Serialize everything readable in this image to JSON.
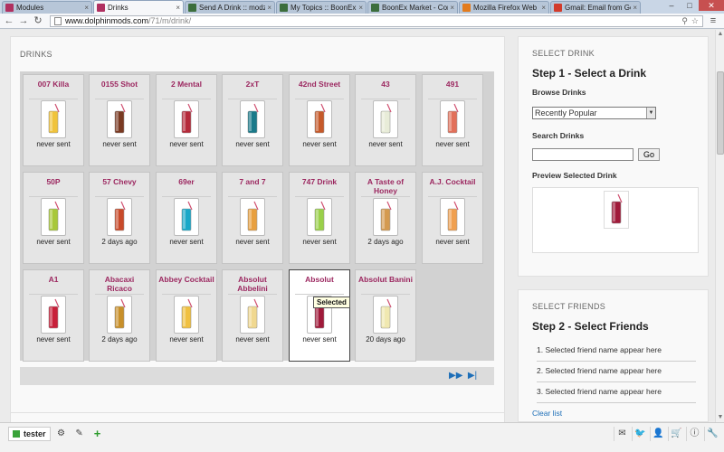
{
  "browser": {
    "tabs": [
      {
        "title": "Modules",
        "favicon_color": "#b03060"
      },
      {
        "title": "Drinks",
        "favicon_color": "#b03060"
      },
      {
        "title": "Send A Drink :: modzzz",
        "favicon_color": "#3c6e3c"
      },
      {
        "title": "My Topics :: BoonEx Uni",
        "favicon_color": "#3c6e3c"
      },
      {
        "title": "BoonEx Market - Comm",
        "favicon_color": "#3c6e3c"
      },
      {
        "title": "Mozilla Firefox Web Bro",
        "favicon_color": "#e27b1e"
      },
      {
        "title": "Gmail: Email from Goog",
        "favicon_color": "#d23b2b"
      }
    ],
    "active_tab_index": 1,
    "url_host": "www.dolphinmods.com",
    "url_path": "/71/m/drink/"
  },
  "drinks": {
    "title": "DRINKS",
    "items": [
      {
        "name": "007 Killa",
        "status": "never sent",
        "color": "#f0c33c"
      },
      {
        "name": "0155 Shot",
        "status": "never sent",
        "color": "#7a3a22"
      },
      {
        "name": "2 Mental",
        "status": "never sent",
        "color": "#b52a3a"
      },
      {
        "name": "2xT",
        "status": "never sent",
        "color": "#1b7a8a"
      },
      {
        "name": "42nd Street",
        "status": "never sent",
        "color": "#c65a2a"
      },
      {
        "name": "43",
        "status": "never sent",
        "color": "#e8ecd8"
      },
      {
        "name": "491",
        "status": "never sent",
        "color": "#e2705a"
      },
      {
        "name": "50P",
        "status": "never sent",
        "color": "#a8c83a"
      },
      {
        "name": "57 Chevy",
        "status": "2 days ago",
        "color": "#c84a2a"
      },
      {
        "name": "69er",
        "status": "never sent",
        "color": "#1aa8c8"
      },
      {
        "name": "7 and 7",
        "status": "never sent",
        "color": "#e8a040"
      },
      {
        "name": "747 Drink",
        "status": "never sent",
        "color": "#9ad04a"
      },
      {
        "name": "A Taste of Honey",
        "status": "2 days ago",
        "color": "#d49a50"
      },
      {
        "name": "A.J. Cocktail",
        "status": "never sent",
        "color": "#f0a050"
      },
      {
        "name": "A1",
        "status": "never sent",
        "color": "#c8203a"
      },
      {
        "name": "Abacaxi Ricaco",
        "status": "2 days ago",
        "color": "#c8902a"
      },
      {
        "name": "Abbey Cocktail",
        "status": "never sent",
        "color": "#f0c040"
      },
      {
        "name": "Absolut Abbelini",
        "status": "never sent",
        "color": "#f0d890"
      },
      {
        "name": "Absolut",
        "status": "never sent",
        "color": "#a01a3a"
      },
      {
        "name": "Absolut Banini",
        "status": "20 days ago",
        "color": "#f0e8b0"
      }
    ],
    "selected_index": 18,
    "tooltip": "Selected"
  },
  "select_drink": {
    "title": "SELECT DRINK",
    "step_title": "Step 1 - Select a Drink",
    "browse_label": "Browse Drinks",
    "browse_value": "Recently Popular",
    "search_label": "Search Drinks",
    "search_value": "",
    "go_label": "Go",
    "preview_label": "Preview Selected Drink",
    "preview_color": "#a01a3a"
  },
  "select_friends": {
    "title": "SELECT FRIENDS",
    "step_title": "Step 2 - Select Friends",
    "friends": [
      "1. Selected friend name appear here",
      "2. Selected friend name appear here",
      "3. Selected friend name appear here"
    ],
    "clear_label": "Clear list"
  },
  "toolbar": {
    "username": "tester",
    "status_color": "#3aa33a",
    "left_icons": [
      "gear-icon",
      "edit-icon",
      "plus-icon"
    ],
    "right_icons": [
      "mail-icon",
      "twitter-icon",
      "user-icon",
      "cart-icon",
      "info-icon",
      "wrench-icon"
    ]
  }
}
